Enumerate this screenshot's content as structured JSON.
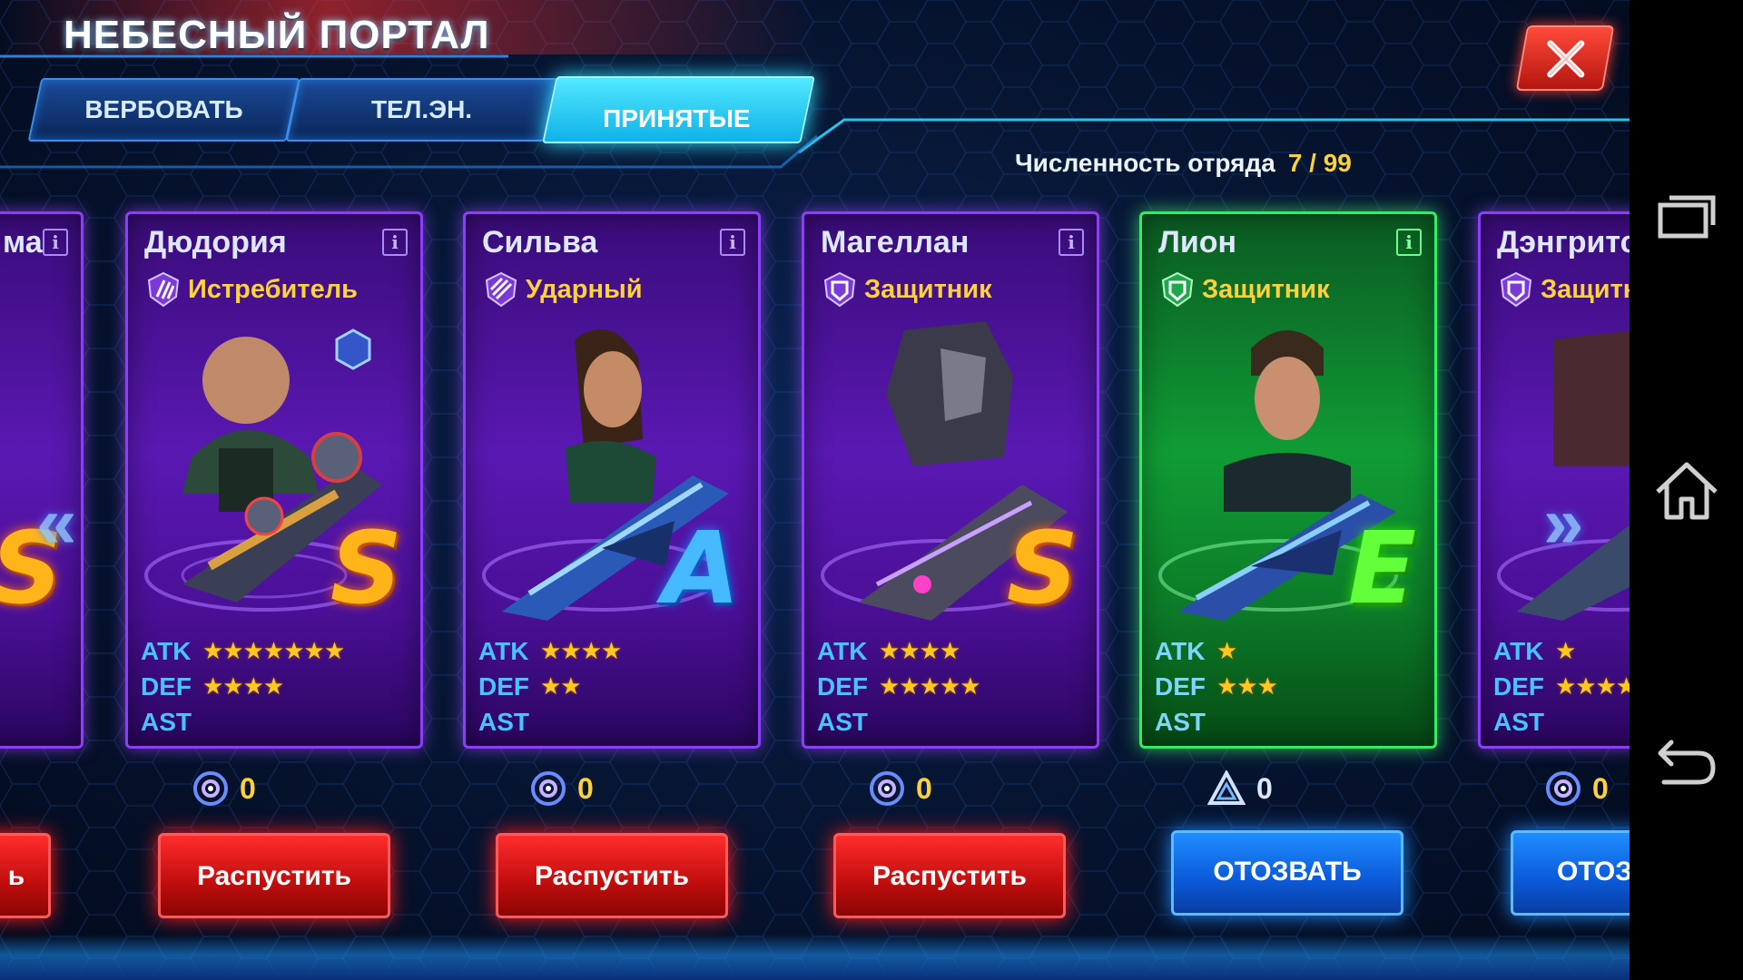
{
  "header": {
    "title": "НЕБЕСНЫЙ ПОРТАЛ"
  },
  "tabs": [
    {
      "label": "ВЕРБОВАТЬ",
      "active": false
    },
    {
      "label": "ТЕЛ.ЭН.",
      "active": false
    },
    {
      "label": "ПРИНЯТЫЕ",
      "active": true
    }
  ],
  "squad": {
    "label": "Численность отряда",
    "count": "7 / 99"
  },
  "colors": {
    "accent": "#2fe0ff",
    "dismiss": "#e01414",
    "recall": "#0b6be0",
    "star": "#ffc81e"
  },
  "cards": [
    {
      "name": "Дюдория",
      "role": "Истребитель",
      "role_icon": "claw-icon",
      "rank": "S",
      "atk_label": "ATK",
      "atk_stars": "★★★★★★★",
      "def_label": "DEF",
      "def_stars": "★★★★",
      "ast_label": "AST",
      "cost": "0",
      "cost_icon": "target-icon",
      "button": "Распустить",
      "status": "purple"
    },
    {
      "name": "Сильва",
      "role": "Ударный",
      "role_icon": "strike-icon",
      "rank": "A",
      "atk_label": "ATK",
      "atk_stars": "★★★★",
      "def_label": "DEF",
      "def_stars": "★★",
      "ast_label": "AST",
      "cost": "0",
      "cost_icon": "target-icon",
      "button": "Распустить",
      "status": "purple"
    },
    {
      "name": "Магеллан",
      "role": "Защитник",
      "role_icon": "shield-icon",
      "rank": "S",
      "atk_label": "ATK",
      "atk_stars": "★★★★",
      "def_label": "DEF",
      "def_stars": "★★★★★",
      "ast_label": "AST",
      "cost": "0",
      "cost_icon": "target-icon",
      "button": "Распустить",
      "status": "purple"
    },
    {
      "name": "Лион",
      "role": "Защитник",
      "role_icon": "shield-icon",
      "rank": "E",
      "atk_label": "ATK",
      "atk_stars": "★",
      "def_label": "DEF",
      "def_stars": "★★★",
      "ast_label": "AST",
      "cost": "0",
      "cost_icon": "triangle-icon",
      "button": "ОТОЗВАТЬ",
      "status": "green"
    }
  ],
  "partial_left": {
    "name": "ма",
    "rank": "S",
    "button": "ь"
  },
  "partial_right": {
    "name": "Дэнгритс",
    "role": "Защитн",
    "atk_label": "ATK",
    "atk_stars": "★",
    "def_label": "DEF",
    "def_stars": "★★★★",
    "ast_label": "AST",
    "cost": "0",
    "button": "ОТОЗ"
  },
  "navbar": [
    "recent-apps-icon",
    "home-icon",
    "back-icon"
  ]
}
